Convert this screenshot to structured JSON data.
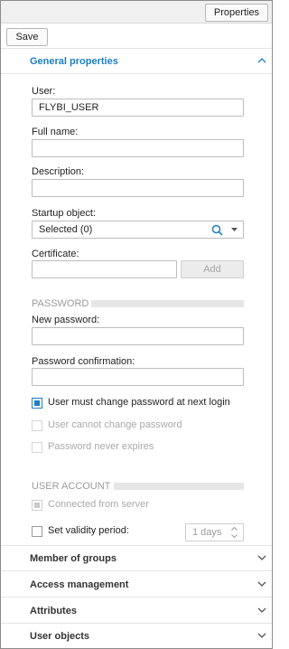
{
  "toolbar": {
    "properties_label": "Properties",
    "save_label": "Save"
  },
  "sections": {
    "general": "General properties",
    "member_of_groups": "Member of groups",
    "access_management": "Access management",
    "attributes": "Attributes",
    "user_objects": "User objects"
  },
  "fields": {
    "user": {
      "label": "User:",
      "value": "FLYBI_USER"
    },
    "full_name": {
      "label": "Full name:",
      "value": ""
    },
    "description": {
      "label": "Description:",
      "value": ""
    },
    "startup_object": {
      "label": "Startup object:",
      "value": "Selected (0)"
    },
    "certificate": {
      "label": "Certificate:",
      "value": "",
      "add_label": "Add"
    },
    "new_password": {
      "label": "New password:",
      "value": ""
    },
    "password_confirmation": {
      "label": "Password confirmation:",
      "value": ""
    }
  },
  "groups": {
    "password": "PASSWORD",
    "user_account": "USER ACCOUNT"
  },
  "checkboxes": {
    "must_change": {
      "label": "User must change password at next login",
      "checked": true,
      "enabled": true
    },
    "cannot_change": {
      "label": "User cannot change password",
      "checked": false,
      "enabled": false
    },
    "never_expires": {
      "label": "Password never expires",
      "checked": false,
      "enabled": false
    },
    "connected_from_server": {
      "label": "Connected from server",
      "checked": true,
      "enabled": false
    },
    "set_validity": {
      "label": "Set validity period:",
      "checked": false,
      "enabled": true
    }
  },
  "validity": {
    "value": "1 days"
  },
  "colors": {
    "accent": "#1d7fc4",
    "disabled_text": "#aaaaaa",
    "group_heading": "#9b9b9b"
  },
  "icons": {
    "chevron_up": "chevron-up-icon",
    "chevron_down": "chevron-down-icon",
    "search": "search-icon",
    "dropdown": "dropdown-arrow-icon"
  }
}
